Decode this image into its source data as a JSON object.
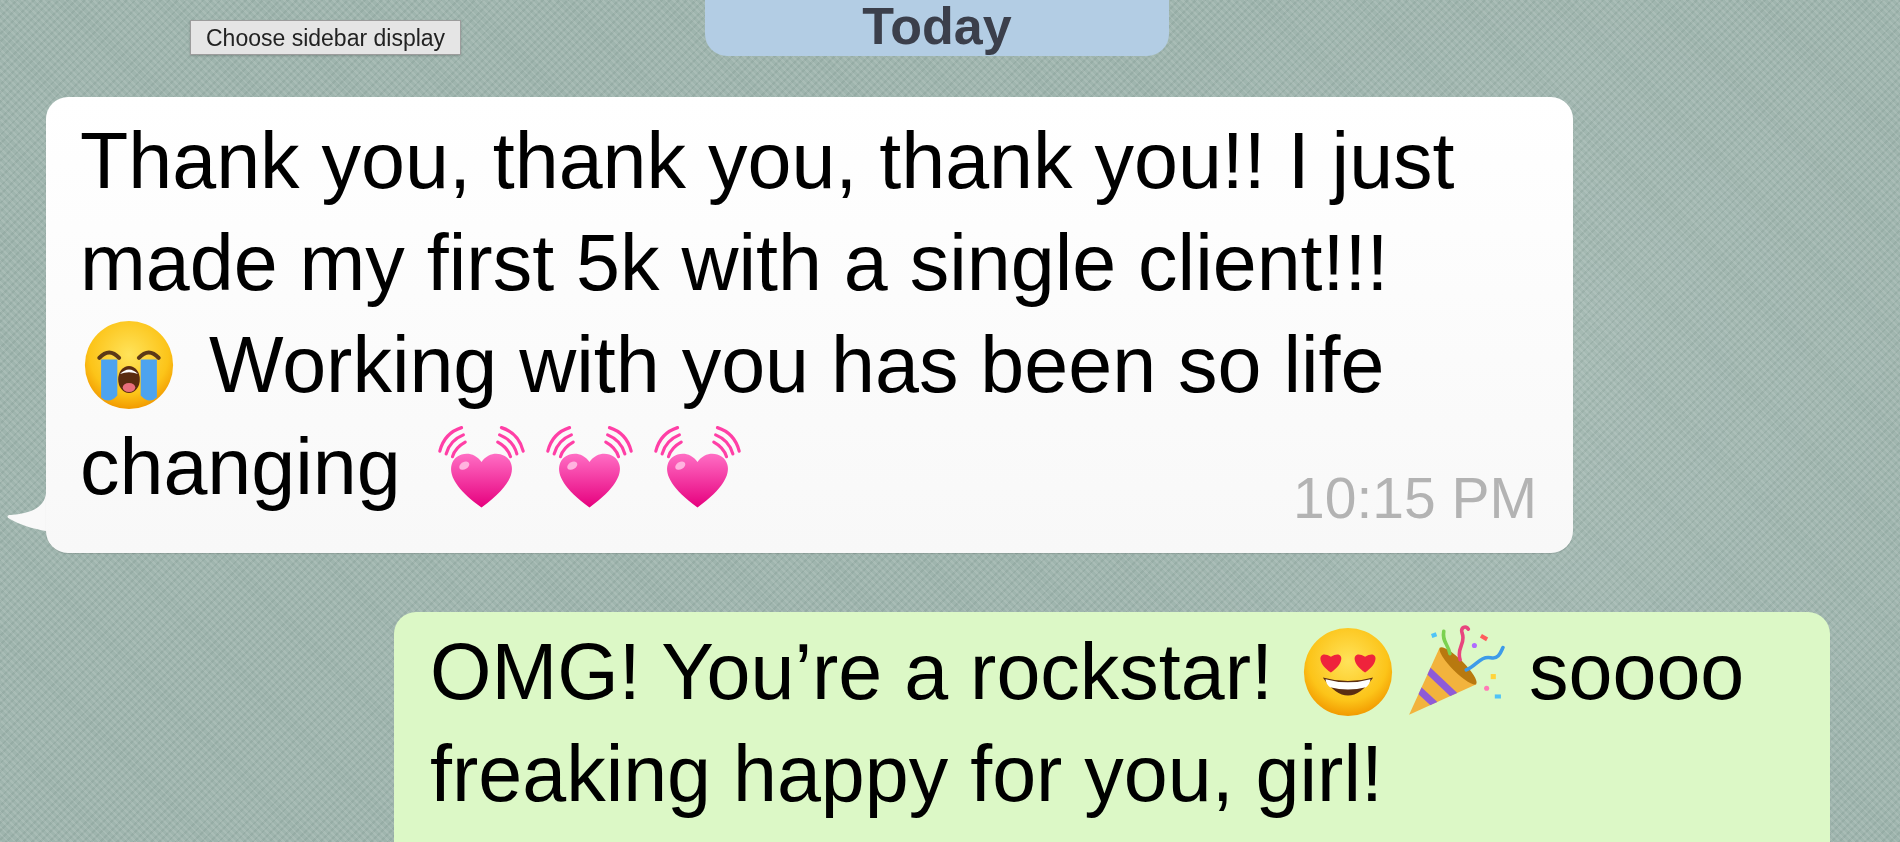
{
  "date_chip": {
    "label": "Today"
  },
  "tooltip": {
    "text": "Choose sidebar display"
  },
  "messages": [
    {
      "kind": "incoming",
      "rows": [
        [
          {
            "kind": "text",
            "text": "Thank you, thank you, thank you!! I just made my first 5k with a single client!!!"
          }
        ],
        [
          {
            "kind": "crying"
          },
          {
            "kind": "text",
            "text": "Working with you has been so life"
          }
        ],
        [
          {
            "kind": "text",
            "text": "changing"
          },
          {
            "kind": "heart"
          },
          {
            "kind": "heart"
          },
          {
            "kind": "heart"
          }
        ]
      ],
      "time": "10:15 PM"
    },
    {
      "kind": "outgoing",
      "rows": [
        [
          {
            "kind": "text",
            "text": "OMG! You’re a rockstar!"
          },
          {
            "kind": "hearteyes"
          },
          {
            "kind": "popper"
          },
          {
            "kind": "text",
            "text": "soooo"
          }
        ],
        [
          {
            "kind": "text",
            "text": "freaking happy for you, girl!"
          }
        ]
      ]
    }
  ]
}
